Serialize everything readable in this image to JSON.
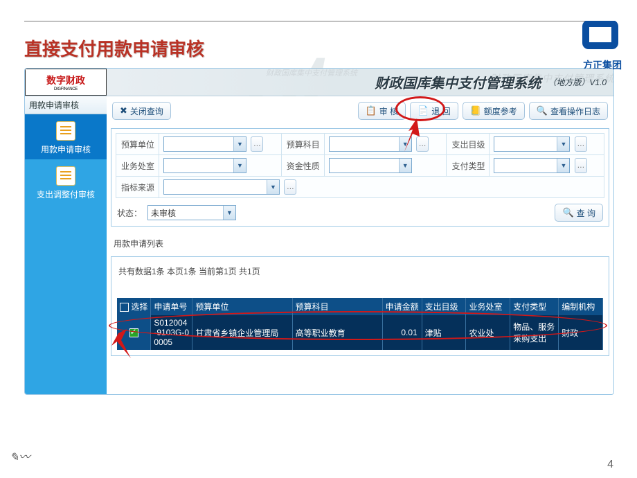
{
  "slide": {
    "title": "直接支付用款申请审核",
    "page_number": "4",
    "corner_mark": "✎〰",
    "company_logo_text": "方正集团"
  },
  "app": {
    "logo_main": "数字财政",
    "logo_sub": "DIGFINANCE",
    "title": "财政国库集中支付管理系统",
    "version": "（地方版）V1.0",
    "ghost_title": "财政国库集中支付管理系统",
    "ghost_title2": "财政国库集中支付管理系统"
  },
  "sidebar": {
    "header": "用款申请审核",
    "items": [
      {
        "label": "用款申请审核"
      },
      {
        "label": "支出调整付审核"
      }
    ]
  },
  "toolbar": {
    "close_query": "关闭查询",
    "audit": "审 核",
    "return": "退 回",
    "quota_ref": "额度参考",
    "view_log": "查看操作日志"
  },
  "filters": {
    "budget_unit_label": "预算单位",
    "budget_subject_label": "预算科目",
    "expend_cat_label": "支出目级",
    "office_label": "业务处室",
    "fund_nature_label": "资金性质",
    "pay_type_label": "支付类型",
    "index_source_label": "指标来源",
    "status_label": "状态：",
    "status_value": "未审核",
    "query_button": "查 询"
  },
  "list": {
    "title": "用款申请列表",
    "pager_text": "共有数据1条 本页1条 当前第1页 共1页",
    "select_all_label": "选择",
    "columns": {
      "apply_no": "申请单号",
      "budget_unit": "预算单位",
      "budget_subject": "预算科目",
      "apply_amount": "申请金额",
      "expend_cat": "支出目级",
      "office": "业务处室",
      "pay_type": "支付类型",
      "org": "编制机构"
    },
    "row": {
      "apply_no": "S012004-9103G-00005",
      "budget_unit": "甘肃省乡镇企业管理局",
      "budget_subject": "高等职业教育",
      "apply_amount": "0.01",
      "expend_cat": "津贴",
      "office": "农业处",
      "pay_type": "物品、服务采购支出",
      "org": "财政"
    }
  }
}
